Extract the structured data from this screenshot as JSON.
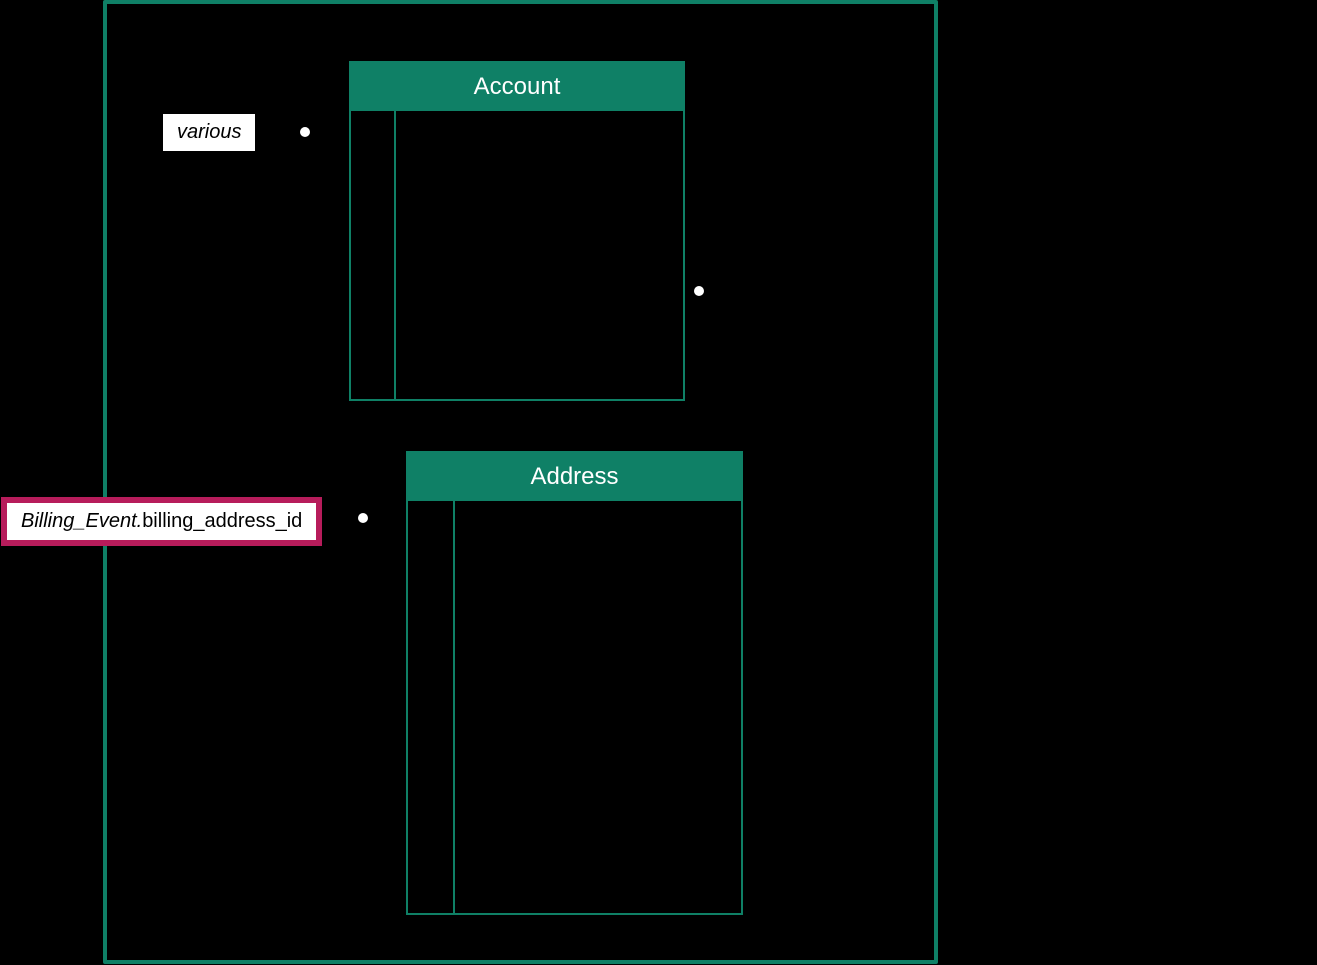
{
  "entities": {
    "account": {
      "title": "Account"
    },
    "address": {
      "title": "Address"
    }
  },
  "labels": {
    "various": "various",
    "billing": {
      "italic_part": "Billing_Event.",
      "normal_part": "billing_address_id"
    }
  }
}
